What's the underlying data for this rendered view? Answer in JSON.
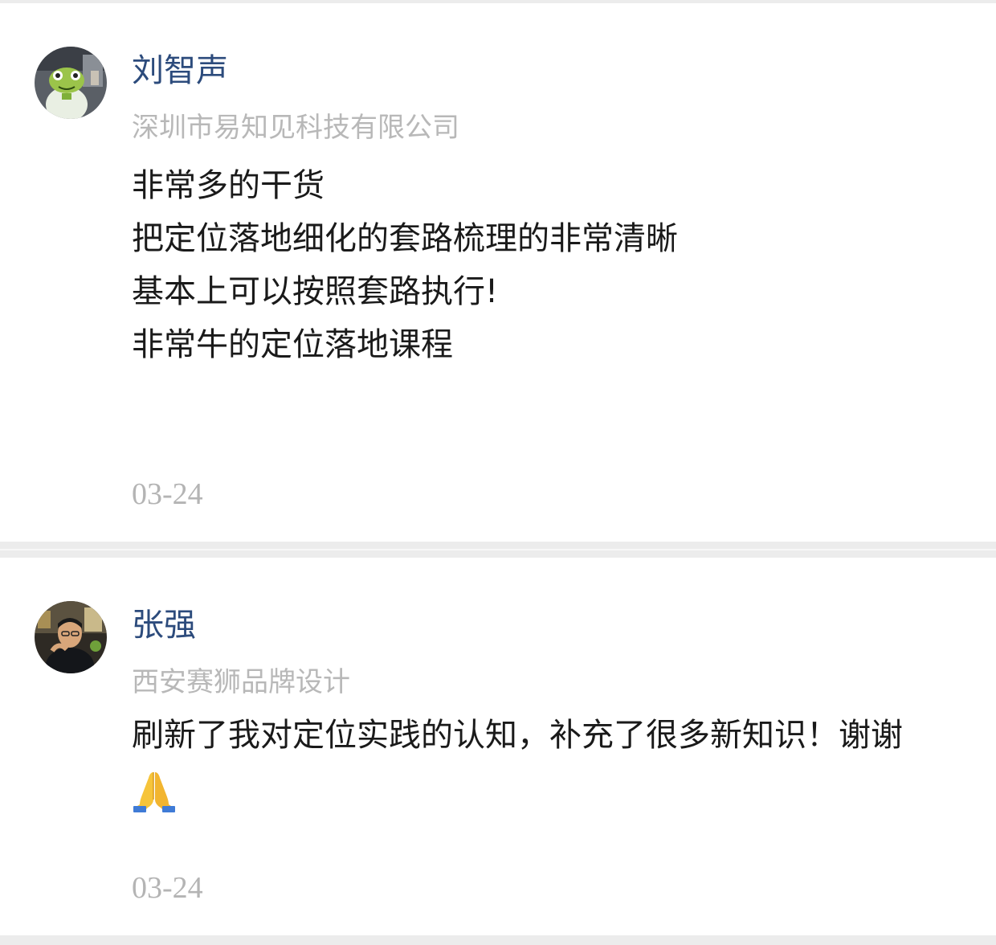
{
  "comments": [
    {
      "name": "刘智声",
      "company": "深圳市易知见科技有限公司",
      "lines": [
        "非常多的干货",
        "把定位落地细化的套路梳理的非常清晰",
        "基本上可以按照套路执行!",
        "非常牛的定位落地课程"
      ],
      "date": "03-24"
    },
    {
      "name": "张强",
      "company": "西安赛狮品牌设计",
      "lines": [
        "刷新了我对定位实践的认知，补充了很多新知识！谢谢"
      ],
      "emoji": "folded-hands-icon",
      "date": "03-24"
    }
  ]
}
